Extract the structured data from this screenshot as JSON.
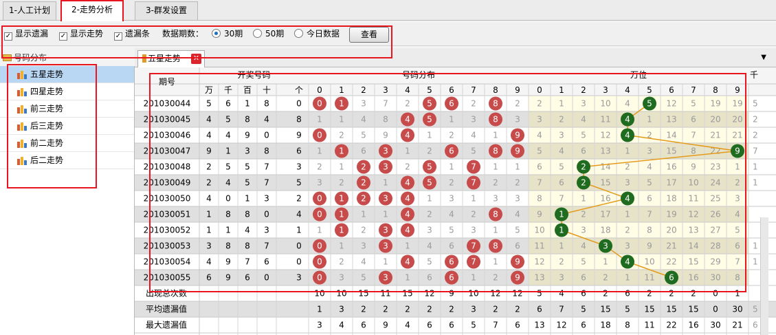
{
  "tabs": [
    {
      "label": "1-人工计划"
    },
    {
      "label": "2-走势分析"
    },
    {
      "label": "3-群发设置"
    }
  ],
  "toolbar": {
    "show_missing": "显示遗漏",
    "show_trend": "显示走势",
    "missing_bar": "遗漏条",
    "period_label": "数据期数：",
    "opt_30": "30期",
    "opt_50": "50期",
    "opt_today": "今日数据",
    "selected_option": "30期",
    "view_button": "查看"
  },
  "tree": {
    "root": "号码分布",
    "items": [
      "五星走势",
      "四星走势",
      "前三走势",
      "后三走势",
      "前二走势",
      "后二走势"
    ],
    "selected": "五星走势"
  },
  "subtab": {
    "label": "五星走势",
    "close": "✕"
  },
  "table": {
    "period_header": "期号",
    "open_header": "开奖号码",
    "dist_header": "号码分布",
    "pos_header": "万位",
    "extra_header": "千",
    "open_cols": [
      "万",
      "千",
      "百",
      "十",
      "个"
    ],
    "digits": [
      "0",
      "1",
      "2",
      "3",
      "4",
      "5",
      "6",
      "7",
      "8",
      "9"
    ],
    "rows": [
      {
        "period": "201030044",
        "open": [
          5,
          6,
          1,
          8,
          0
        ],
        "dist": [
          0,
          0,
          3,
          7,
          2,
          0,
          0,
          2,
          0,
          2
        ],
        "hits": [
          0,
          1,
          5,
          6,
          8
        ],
        "pos": [
          2,
          1,
          3,
          10,
          4,
          0,
          12,
          5,
          19,
          19
        ]
      },
      {
        "period": "201030045",
        "open": [
          4,
          5,
          8,
          4,
          8
        ],
        "dist": [
          1,
          1,
          4,
          8,
          0,
          0,
          1,
          3,
          0,
          3
        ],
        "hits": [
          4,
          5,
          8
        ],
        "pos": [
          3,
          2,
          4,
          11,
          0,
          1,
          13,
          6,
          20,
          20
        ]
      },
      {
        "period": "201030046",
        "open": [
          4,
          4,
          9,
          0,
          9
        ],
        "dist": [
          0,
          2,
          5,
          9,
          0,
          1,
          2,
          4,
          1,
          0
        ],
        "hits": [
          0,
          4,
          9
        ],
        "pos": [
          4,
          3,
          5,
          12,
          0,
          2,
          14,
          7,
          21,
          21
        ]
      },
      {
        "period": "201030047",
        "open": [
          9,
          1,
          3,
          8,
          6
        ],
        "dist": [
          1,
          0,
          6,
          0,
          1,
          2,
          0,
          5,
          0,
          0
        ],
        "hits": [
          1,
          3,
          6,
          8,
          9
        ],
        "pos": [
          5,
          4,
          6,
          13,
          1,
          3,
          15,
          8,
          22,
          0
        ]
      },
      {
        "period": "201030048",
        "open": [
          2,
          5,
          5,
          7,
          3
        ],
        "dist": [
          2,
          1,
          0,
          0,
          2,
          0,
          1,
          0,
          1,
          1
        ],
        "hits": [
          2,
          3,
          5,
          7
        ],
        "pos": [
          6,
          5,
          0,
          14,
          2,
          4,
          16,
          9,
          23,
          1
        ]
      },
      {
        "period": "201030049",
        "open": [
          2,
          4,
          5,
          7,
          5
        ],
        "dist": [
          3,
          2,
          0,
          1,
          0,
          0,
          2,
          0,
          2,
          2
        ],
        "hits": [
          2,
          4,
          5,
          7
        ],
        "pos": [
          7,
          6,
          0,
          15,
          3,
          5,
          17,
          10,
          24,
          2
        ]
      },
      {
        "period": "201030050",
        "open": [
          4,
          0,
          1,
          3,
          2
        ],
        "dist": [
          0,
          0,
          0,
          0,
          0,
          1,
          3,
          1,
          3,
          3
        ],
        "hits": [
          0,
          1,
          2,
          3,
          4
        ],
        "pos": [
          8,
          7,
          1,
          16,
          0,
          6,
          18,
          11,
          25,
          3
        ]
      },
      {
        "period": "201030051",
        "open": [
          1,
          8,
          8,
          0,
          4
        ],
        "dist": [
          0,
          0,
          1,
          1,
          0,
          2,
          4,
          2,
          0,
          4
        ],
        "hits": [
          0,
          1,
          4,
          8
        ],
        "pos": [
          9,
          0,
          2,
          17,
          1,
          7,
          19,
          12,
          26,
          4
        ]
      },
      {
        "period": "201030052",
        "open": [
          1,
          1,
          4,
          3,
          1
        ],
        "dist": [
          1,
          0,
          2,
          0,
          0,
          3,
          5,
          3,
          1,
          5
        ],
        "hits": [
          1,
          3,
          4
        ],
        "pos": [
          10,
          0,
          3,
          18,
          2,
          8,
          20,
          13,
          27,
          5
        ]
      },
      {
        "period": "201030053",
        "open": [
          3,
          8,
          8,
          7,
          0
        ],
        "dist": [
          0,
          1,
          3,
          0,
          1,
          4,
          6,
          0,
          0,
          6
        ],
        "hits": [
          0,
          3,
          7,
          8
        ],
        "pos": [
          11,
          1,
          4,
          0,
          3,
          9,
          21,
          14,
          28,
          6
        ]
      },
      {
        "period": "201030054",
        "open": [
          4,
          9,
          7,
          6,
          0
        ],
        "dist": [
          0,
          2,
          4,
          1,
          0,
          5,
          0,
          0,
          1,
          0
        ],
        "hits": [
          0,
          4,
          6,
          7,
          9
        ],
        "pos": [
          12,
          2,
          5,
          1,
          0,
          10,
          22,
          15,
          29,
          7
        ]
      },
      {
        "period": "201030055",
        "open": [
          6,
          9,
          6,
          0,
          3
        ],
        "dist": [
          0,
          3,
          5,
          0,
          1,
          6,
          0,
          1,
          2,
          0
        ],
        "hits": [
          0,
          3,
          6,
          9
        ],
        "pos": [
          13,
          3,
          6,
          2,
          1,
          11,
          0,
          16,
          30,
          8
        ]
      }
    ],
    "footer": [
      {
        "label": "出现总次数",
        "dist": [
          10,
          10,
          15,
          11,
          15,
          12,
          9,
          10,
          12,
          12
        ],
        "pos": [
          5,
          4,
          6,
          2,
          6,
          2,
          2,
          2,
          0,
          1
        ]
      },
      {
        "label": "平均遗漏值",
        "dist": [
          1,
          3,
          2,
          2,
          2,
          2,
          2,
          3,
          2,
          2
        ],
        "pos": [
          6,
          7,
          5,
          15,
          5,
          15,
          15,
          15,
          0,
          30
        ]
      },
      {
        "label": "最大遗漏值",
        "dist": [
          3,
          4,
          6,
          9,
          4,
          6,
          6,
          5,
          7,
          6
        ],
        "pos": [
          13,
          12,
          6,
          18,
          8,
          11,
          22,
          16,
          30,
          21
        ]
      }
    ],
    "edge_col": [
      "5",
      "2",
      "2",
      "7",
      "1",
      "1",
      "",
      "",
      "",
      "1",
      "1",
      "",
      "",
      "5",
      "6",
      "1"
    ]
  },
  "colors": {
    "hit": "#c74b4b",
    "pos_hit": "#1f6b1f",
    "line": "#e59a1a",
    "pos_bg": "#fffde6",
    "alt_row": "#e0e0e0",
    "highlight_box": "#e8141e",
    "selected_item": "#b9d6f3"
  }
}
